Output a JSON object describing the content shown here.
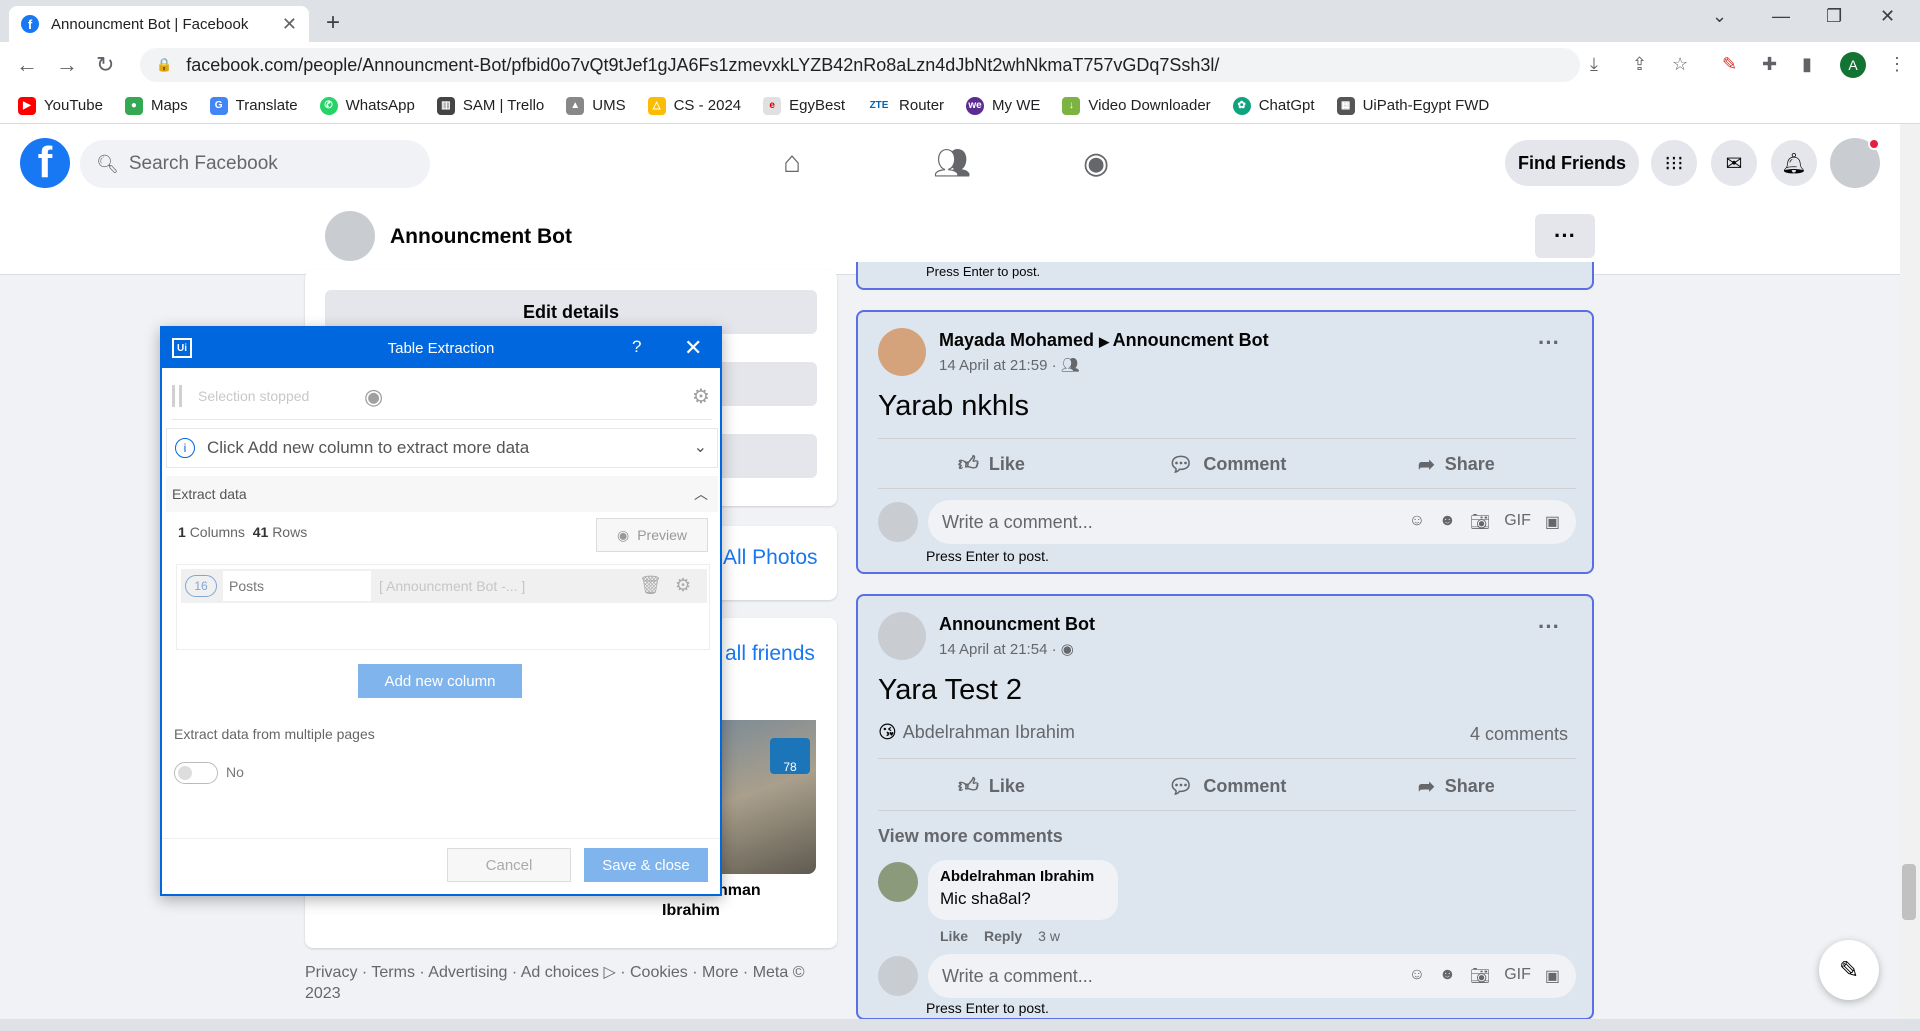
{
  "browser": {
    "tab_title": "Announcment Bot | Facebook",
    "url_host": "facebook.com",
    "url_path": "/people/Announcment-Bot/pfbid0o7vQt9tJef1gJA6Fs1zmevxkLYZB42nRo8aLzn4dJbNt2whNkmaT757vGDq7Ssh3l/",
    "profile_initial": "A",
    "bookmarks": [
      "YouTube",
      "Maps",
      "Translate",
      "WhatsApp",
      "SAM | Trello",
      "UMS",
      "CS - 2024",
      "EgyBest",
      "Router",
      "My WE",
      "Video Downloader",
      "ChatGpt",
      "UiPath-Egypt FWD"
    ]
  },
  "fb": {
    "search_placeholder": "Search Facebook",
    "find_friends": "Find Friends",
    "page_name": "Announcment Bot"
  },
  "left": {
    "edit_details": "Edit details",
    "all_photos": "All Photos",
    "all_friends": "all friends",
    "friend_name_1": "hman",
    "friend_name_2": "Ibrahim",
    "footer": "Privacy · Terms · Advertising · Ad choices ▷ · Cookies · More · Meta © 2023"
  },
  "post0": {
    "hint": "Press Enter to post."
  },
  "post1": {
    "author": "Mayada Mohamed",
    "target": "Announcment Bot",
    "meta": "14 April at 21:59 ·",
    "text": "Yarab nkhls",
    "like": "Like",
    "comment": "Comment",
    "share": "Share",
    "comment_placeholder": "Write a comment...",
    "hint": "Press Enter to post."
  },
  "post2": {
    "author": "Announcment Bot",
    "meta": "14 April at 21:54 ·",
    "text": "Yara Test 2",
    "reactor": "Abdelrahman Ibrahim",
    "comments_count": "4 comments",
    "like": "Like",
    "comment": "Comment",
    "share": "Share",
    "view_more": "View more comments",
    "c_author": "Abdelrahman Ibrahim",
    "c_text": "Mic sha8al?",
    "c_like": "Like",
    "c_reply": "Reply",
    "c_time": "3 w",
    "comment_placeholder": "Write a comment...",
    "hint": "Press Enter to post."
  },
  "dialog": {
    "logo": "Ui",
    "title": "Table Extraction",
    "help": "?",
    "close": "✕",
    "selection_status": "Selection stopped",
    "info": "Click Add new column to extract more data",
    "extract_section": "Extract data",
    "columns_count": "1",
    "columns_label": "Columns",
    "rows_count": "41",
    "rows_label": "Rows",
    "preview": "Preview",
    "column_index": "16",
    "column_name": "Posts",
    "column_value": "[ Announcment Bot -... ]",
    "add_column": "Add new column",
    "multi_pages": "Extract data from multiple pages",
    "toggle_label": "No",
    "cancel": "Cancel",
    "save": "Save & close"
  },
  "colors": {
    "fb_blue": "#1877f2",
    "uipath_blue": "#0067df",
    "post_border": "#5a6ee6",
    "post_bg": "#dde6ef"
  }
}
